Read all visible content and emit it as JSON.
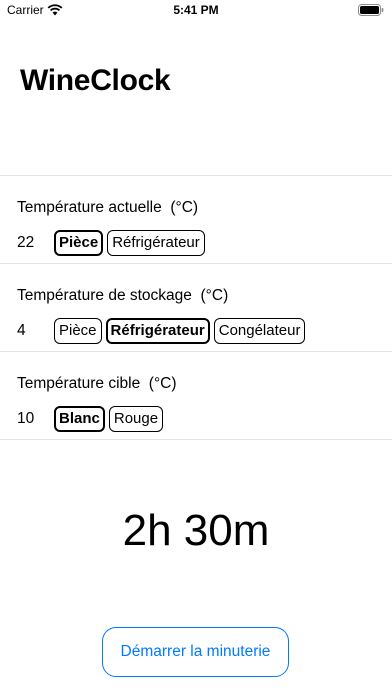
{
  "status_bar": {
    "carrier": "Carrier",
    "time": "5:41 PM",
    "icons": [
      "wifi-icon",
      "battery-icon"
    ]
  },
  "app": {
    "title": "WineClock"
  },
  "sections": {
    "current": {
      "label": "Température actuelle  (°C)",
      "value": "22",
      "options": [
        {
          "label": "Pièce",
          "selected": true
        },
        {
          "label": "Réfrigérateur",
          "selected": false
        }
      ]
    },
    "storage": {
      "label": "Température de stockage  (°C)",
      "value": "4",
      "options": [
        {
          "label": "Pièce",
          "selected": false
        },
        {
          "label": "Réfrigérateur",
          "selected": true
        },
        {
          "label": "Congélateur",
          "selected": false
        }
      ]
    },
    "target": {
      "label": "Température cible  (°C)",
      "value": "10",
      "options": [
        {
          "label": "Blanc",
          "selected": true
        },
        {
          "label": "Rouge",
          "selected": false
        }
      ]
    }
  },
  "timer": {
    "display": "2h 30m"
  },
  "start_button": {
    "label": "Démarrer la minuterie"
  },
  "colors": {
    "accent": "#007aff",
    "divider": "#e3e3e6"
  }
}
